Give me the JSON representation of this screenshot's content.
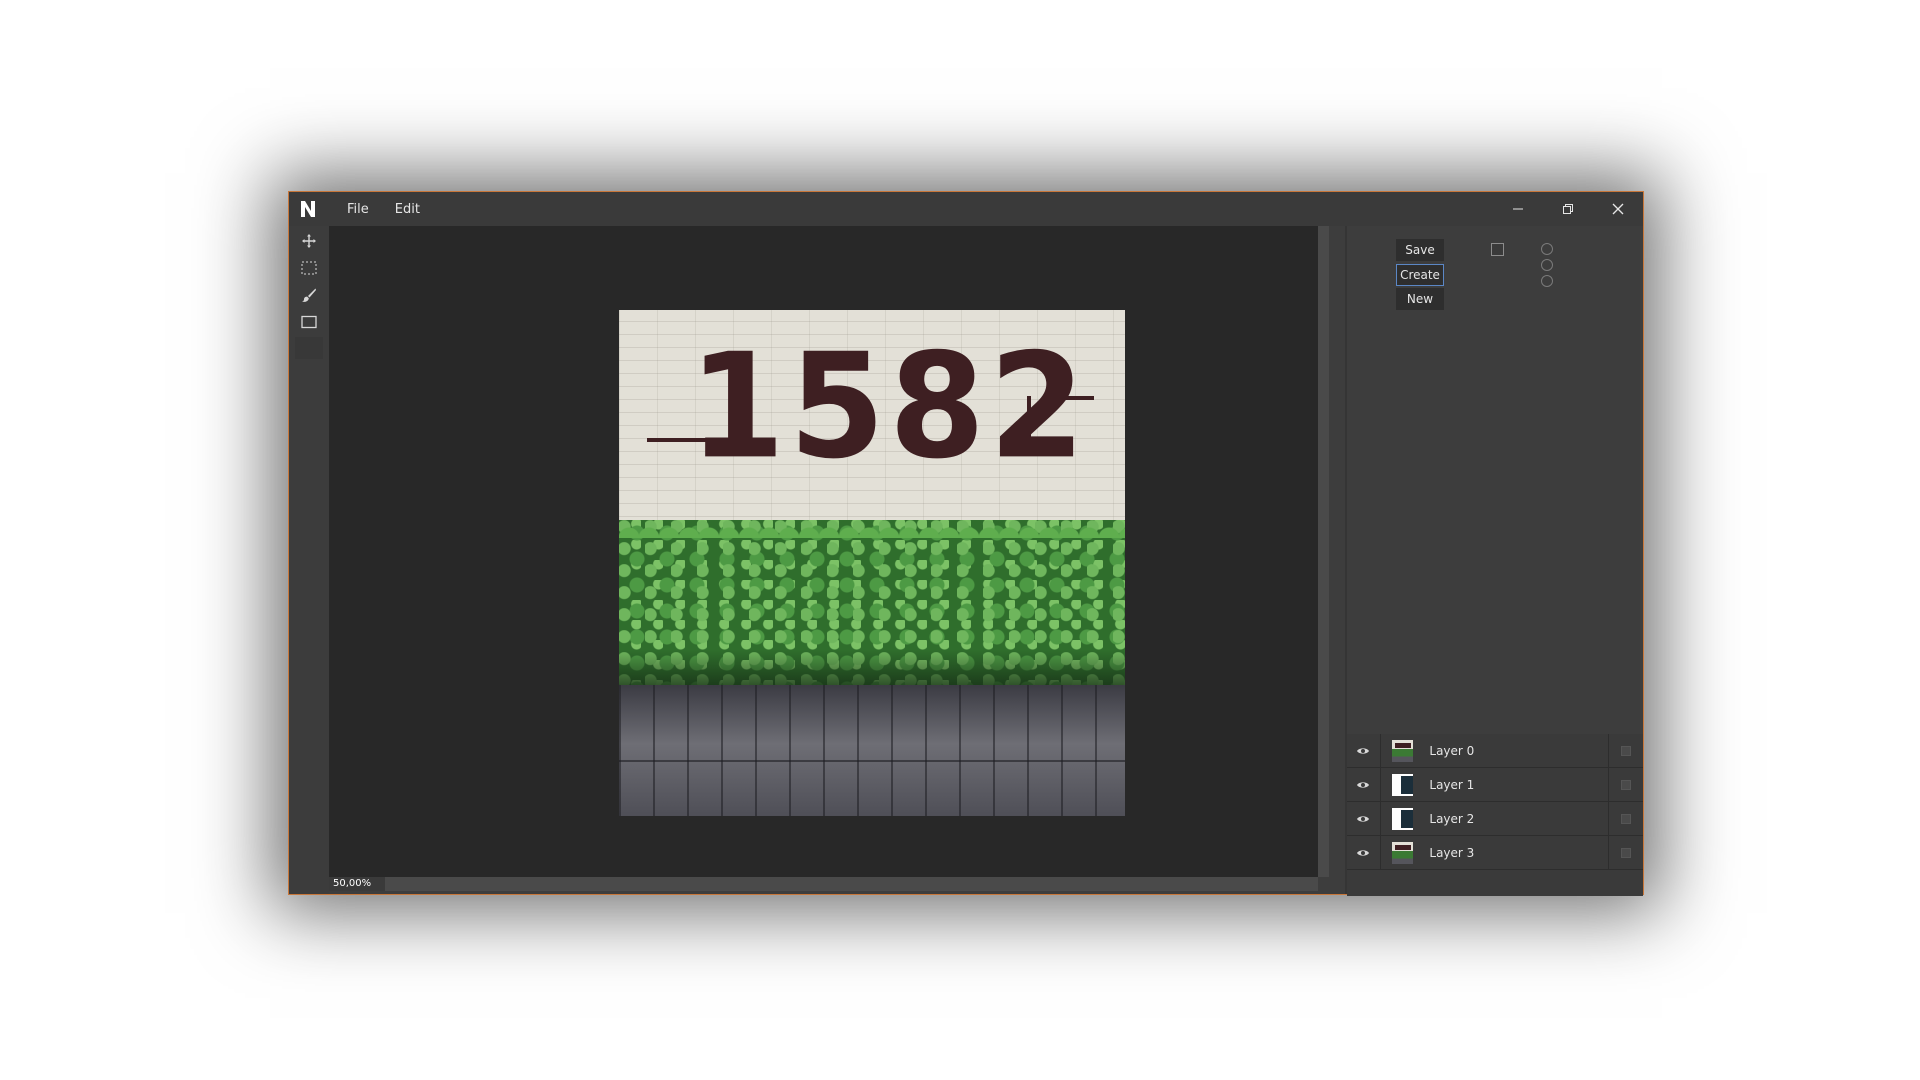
{
  "menu": {
    "file": "File",
    "edit": "Edit"
  },
  "artwork": {
    "year": "1582"
  },
  "status": {
    "zoom": "50,00%"
  },
  "panel": {
    "save_label": "Save",
    "create_label": "Create",
    "new_label": "New"
  },
  "layers": [
    {
      "name": "Layer 0",
      "thumb": "full-image"
    },
    {
      "name": "Layer 1",
      "thumb": "mask"
    },
    {
      "name": "Layer 2",
      "thumb": "mask"
    },
    {
      "name": "Layer 3",
      "thumb": "full-image"
    }
  ],
  "colors": {
    "window_border": "#c8773a",
    "focus_accent": "#5b87c6"
  }
}
